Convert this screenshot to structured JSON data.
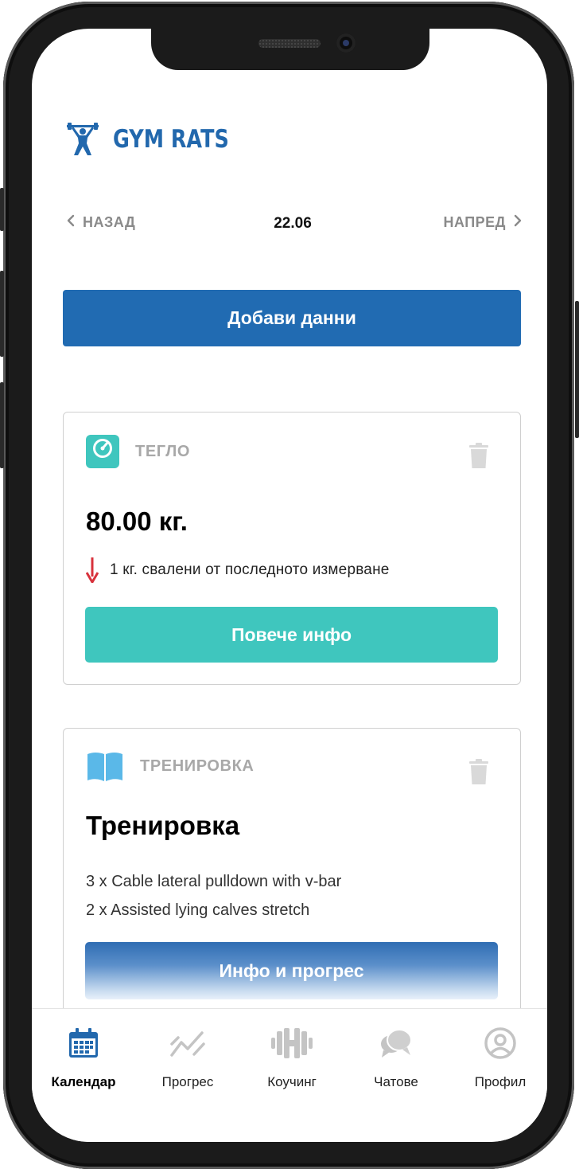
{
  "app": {
    "name": "GYM RATS"
  },
  "date_nav": {
    "back_label": "НАЗАД",
    "date": "22.06",
    "next_label": "НАПРЕД"
  },
  "add_data_button": "Добави данни",
  "weight_card": {
    "label": "ТЕГЛО",
    "value": "80.00 кг.",
    "delta_text": "1 кг. свалени от последното измерване",
    "button": "Повече инфо"
  },
  "workout_card": {
    "label": "ТРЕНИРОВКА",
    "title": "Тренировка",
    "exercises": [
      "3 x Cable lateral pulldown with v-bar",
      "2 x Assisted lying calves stretch"
    ],
    "button": "Инфо и прогрес"
  },
  "tabs": [
    {
      "label": "Календар",
      "icon": "calendar-icon",
      "active": true
    },
    {
      "label": "Прогрес",
      "icon": "chart-line-icon",
      "active": false
    },
    {
      "label": "Коучинг",
      "icon": "dumbbell-icon",
      "active": false
    },
    {
      "label": "Чатове",
      "icon": "chat-bubbles-icon",
      "active": false
    },
    {
      "label": "Профил",
      "icon": "user-circle-icon",
      "active": false
    }
  ],
  "colors": {
    "primary": "#216bb2",
    "teal": "#3fc6be",
    "alert": "#d8323c",
    "muted": "#a8a8a8"
  }
}
